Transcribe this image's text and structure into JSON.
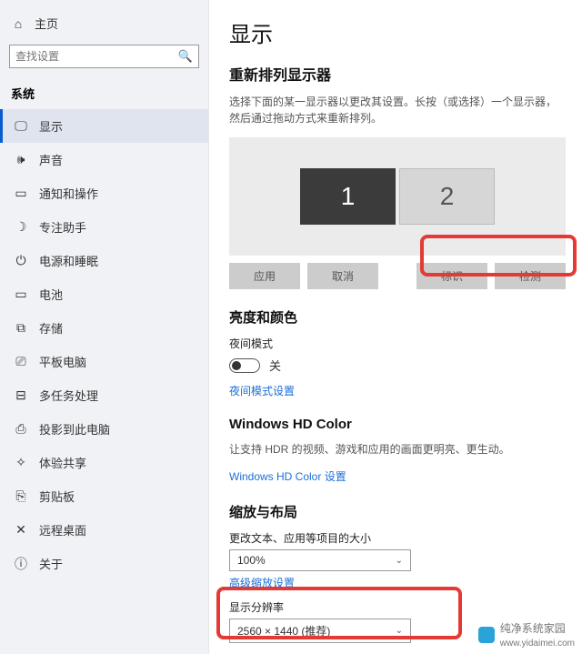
{
  "sidebar": {
    "home": "主页",
    "search_placeholder": "查找设置",
    "category": "系统",
    "items": [
      {
        "label": "显示"
      },
      {
        "label": "声音"
      },
      {
        "label": "通知和操作"
      },
      {
        "label": "专注助手"
      },
      {
        "label": "电源和睡眠"
      },
      {
        "label": "电池"
      },
      {
        "label": "存储"
      },
      {
        "label": "平板电脑"
      },
      {
        "label": "多任务处理"
      },
      {
        "label": "投影到此电脑"
      },
      {
        "label": "体验共享"
      },
      {
        "label": "剪贴板"
      },
      {
        "label": "远程桌面"
      },
      {
        "label": "关于"
      }
    ]
  },
  "main": {
    "title": "显示",
    "rearrange_title": "重新排列显示器",
    "rearrange_desc": "选择下面的某一显示器以更改其设置。长按（或选择）一个显示器，然后通过拖动方式来重新排列。",
    "monitors": {
      "m1": "1",
      "m2": "2"
    },
    "buttons": {
      "apply": "应用",
      "cancel": "取消",
      "identify": "标识",
      "detect": "检测"
    },
    "brightness_title": "亮度和颜色",
    "night_light_label": "夜间模式",
    "night_light_state": "关",
    "night_light_settings": "夜间模式设置",
    "hdr_title": "Windows HD Color",
    "hdr_desc": "让支持 HDR 的视频、游戏和应用的画面更明亮、更生动。",
    "hdr_link": "Windows HD Color 设置",
    "scale_title": "缩放与布局",
    "scale_label": "更改文本、应用等项目的大小",
    "scale_value": "100%",
    "scale_advanced": "高级缩放设置",
    "resolution_label": "显示分辨率",
    "resolution_value": "2560 × 1440 (推荐)"
  },
  "footer": {
    "text": "纯净系统家园",
    "url": "www.yidaimei.com"
  }
}
